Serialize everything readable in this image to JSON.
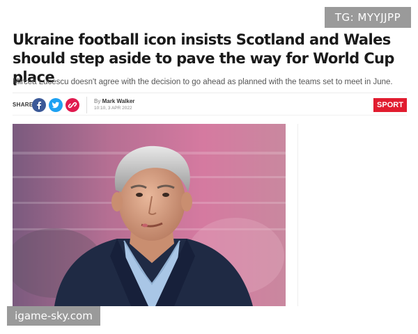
{
  "watermark_top": "TG: MYYJJPP",
  "article": {
    "headline": "Ukraine football icon insists Scotland and Wales should step aside to pave the way for World Cup place",
    "standfirst": "Mircea Lucescu doesn't agree with the decision to go ahead as planned with the teams set to meet in June.",
    "share_label": "SHARE",
    "author_prefix": "By",
    "author": "Mark Walker",
    "date": "10:10, 3 APR 2022",
    "section": "SPORT"
  },
  "share_icons": [
    "facebook-icon",
    "twitter-icon",
    "link-icon"
  ],
  "colors": {
    "facebook": "#3b5998",
    "twitter": "#1da1f2",
    "link": "#e01a4f",
    "section_tag": "#e11c2f"
  },
  "watermark_bottom": "igame-sky.com"
}
